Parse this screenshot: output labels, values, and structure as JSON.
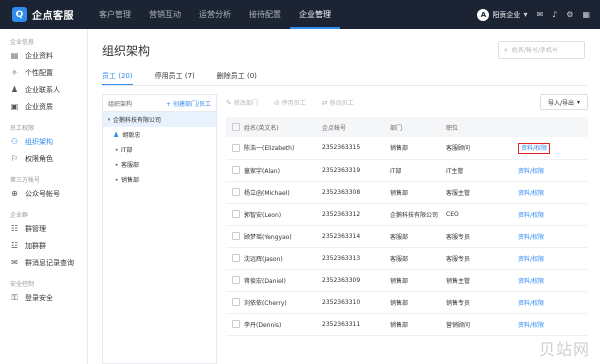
{
  "header": {
    "logo_text": "企点客服",
    "logo_mark": "Q",
    "nav": [
      "客户管理",
      "营销互动",
      "运营分析",
      "接待配置",
      "企业管理"
    ],
    "active_nav": 4,
    "company_mark": "A",
    "company": "阳贡企业",
    "company_dropdown": "▾",
    "icons": [
      "mail-icon",
      "bell-icon",
      "settings-icon",
      "grid-icon"
    ]
  },
  "sidebar": {
    "groups": [
      {
        "title": "企业信息",
        "items": [
          {
            "label": "企业资料",
            "icon": "▤"
          },
          {
            "label": "个性配置",
            "icon": "✧"
          },
          {
            "label": "企业联系人",
            "icon": "♟"
          },
          {
            "label": "企业资质",
            "icon": "▣"
          }
        ]
      },
      {
        "title": "员工权限",
        "items": [
          {
            "label": "组织架构",
            "icon": "⚇",
            "active": true
          },
          {
            "label": "权限角色",
            "icon": "⚐"
          }
        ]
      },
      {
        "title": "第三方帐号",
        "items": [
          {
            "label": "公众号帐号",
            "icon": "⊕"
          }
        ]
      },
      {
        "title": "企业群",
        "items": [
          {
            "label": "群管理",
            "icon": "☷"
          },
          {
            "label": "加群群",
            "icon": "☳"
          },
          {
            "label": "群消息记录查询",
            "icon": "✉"
          }
        ]
      },
      {
        "title": "安全控制",
        "items": [
          {
            "label": "登录安全",
            "icon": "⚿"
          }
        ]
      }
    ]
  },
  "page": {
    "title": "组织架构",
    "search_placeholder": "姓名/帐号/手机号",
    "tabs": [
      "员工 (20)",
      "停用员工 (7)",
      "删除员工 (0)"
    ]
  },
  "tree": {
    "header": "组织架构",
    "add_label": "+ 创建部门/员工",
    "nodes": [
      {
        "label": "企鹅科技有限公司",
        "caret": "▾",
        "indent": 0,
        "selected": true,
        "type": "dept"
      },
      {
        "label": "胡聪忠",
        "caret": "",
        "indent": 1,
        "selected": false,
        "type": "user"
      },
      {
        "label": "IT部",
        "caret": "▸",
        "indent": 1,
        "selected": false,
        "type": "dept"
      },
      {
        "label": "客服部",
        "caret": "▸",
        "indent": 1,
        "selected": false,
        "type": "dept"
      },
      {
        "label": "销售部",
        "caret": "▸",
        "indent": 1,
        "selected": false,
        "type": "dept"
      }
    ]
  },
  "toolbar": {
    "actions": [
      {
        "label": "修改部门",
        "icon": "✎"
      },
      {
        "label": "停用员工",
        "icon": "⊘"
      },
      {
        "label": "移动员工",
        "icon": "⇄"
      }
    ],
    "import_label": "导入/导出",
    "import_caret": "▾"
  },
  "table": {
    "columns": [
      "姓名(英文名)",
      "企点帐号",
      "部门",
      "职位",
      ""
    ],
    "rows": [
      {
        "name": "陈浩一(Elizabeth)",
        "account": "2352363315",
        "dept": "销售部",
        "role": "客服顾问",
        "action": "资料/权限",
        "highlight": true
      },
      {
        "name": "童家宇(Alan)",
        "account": "2352363319",
        "dept": "IT部",
        "role": "IT主管",
        "action": "资料/权限",
        "highlight": false
      },
      {
        "name": "杨立函(Michael)",
        "account": "2352363308",
        "dept": "销售部",
        "role": "客服主管",
        "action": "资料/权限",
        "highlight": false
      },
      {
        "name": "郭智安(Leon)",
        "account": "2352363312",
        "dept": "企鹅科技有限公司",
        "role": "CEO",
        "action": "资料/权限",
        "highlight": false
      },
      {
        "name": "顾梦瑶(Yengyao)",
        "account": "2352363314",
        "dept": "客服部",
        "role": "客服专员",
        "action": "资料/权限",
        "highlight": false
      },
      {
        "name": "沈远辉(Jason)",
        "account": "2352363313",
        "dept": "客服部",
        "role": "客服专员",
        "action": "资料/权限",
        "highlight": false
      },
      {
        "name": "蒋俊宏(Daniel)",
        "account": "2352363309",
        "dept": "销售部",
        "role": "销售主管",
        "action": "资料/权限",
        "highlight": false
      },
      {
        "name": "刘依依(Cherry)",
        "account": "2352363310",
        "dept": "销售部",
        "role": "销售专员",
        "action": "资料/权限",
        "highlight": false
      },
      {
        "name": "李丹(Dennis)",
        "account": "2352363311",
        "dept": "销售部",
        "role": "营销顾问",
        "action": "资料/权限",
        "highlight": false
      }
    ]
  },
  "watermark": "贝站网",
  "colors": {
    "topbar": "#1c2433",
    "accent": "#2f8cf0",
    "highlight": "#e02424"
  }
}
